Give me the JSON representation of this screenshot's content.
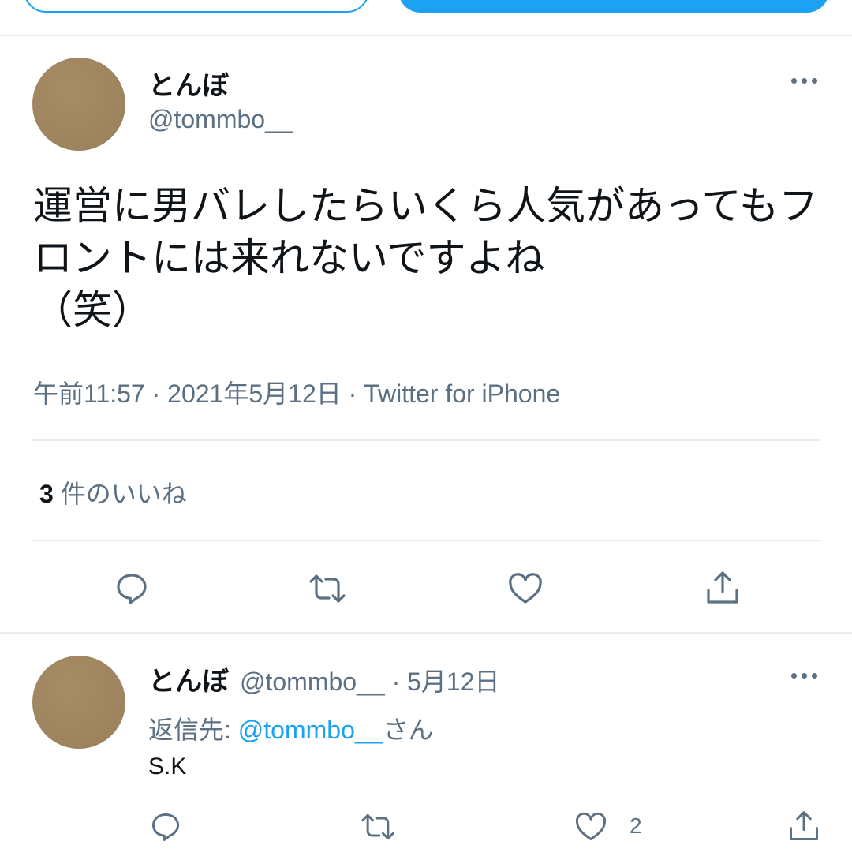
{
  "main_tweet": {
    "display_name": "とんぼ",
    "handle": "@tommbo__",
    "text": "運営に男バレしたらいくら人気があってもフロントには来れないですよね\n（笑）",
    "time": "午前11:57",
    "separator": "·",
    "date": "2021年5月12日",
    "source": "Twitter for iPhone",
    "like_count": "3",
    "like_label": "件のいいね"
  },
  "reply_tweet": {
    "display_name": "とんぼ",
    "handle": "@tommbo__",
    "separator": "·",
    "date": "5月12日",
    "reply_prefix": "返信先:",
    "reply_mention": "@tommbo__",
    "reply_suffix": "さん",
    "text": "S.K",
    "like_count": "2"
  },
  "icons": {
    "reply": "reply-icon",
    "retweet": "retweet-icon",
    "like": "heart-icon",
    "share": "share-icon",
    "more": "more-icon"
  },
  "colors": {
    "accent": "#1da1f2",
    "secondary_text": "#5b7083",
    "divider": "#e6ecf0"
  }
}
